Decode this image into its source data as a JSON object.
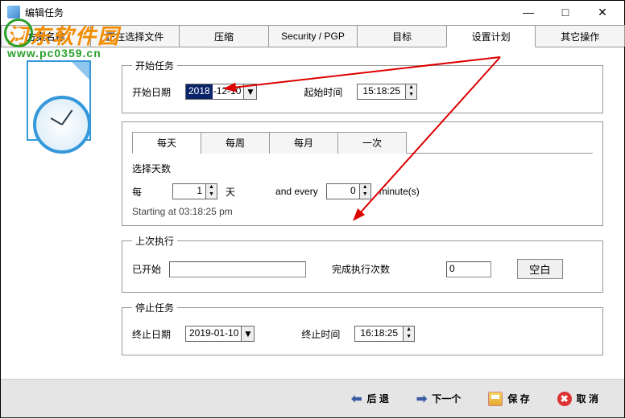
{
  "window": {
    "title": "编辑任务"
  },
  "watermark": {
    "main": "河东软件园",
    "sub": "www.pc0359.cn"
  },
  "tabs": [
    "方案名称",
    "正在选择文件",
    "压缩",
    "Security / PGP",
    "目标",
    "设置计划",
    "其它操作"
  ],
  "active_tab": 5,
  "start_task": {
    "legend": "开始任务",
    "date_label": "开始日期",
    "date_year": "2018",
    "date_rest": "-12-10",
    "time_label": "起始时间",
    "time_value": "15:18:25"
  },
  "freq_tabs": [
    "每天",
    "每周",
    "每月",
    "一次"
  ],
  "freq_active": 0,
  "days": {
    "label": "选择天数",
    "every_label": "每",
    "every_value": "1",
    "every_unit": "天",
    "and_every": "and every",
    "minute_value": "0",
    "minute_unit": "minute(s)",
    "starting": "Starting at 03:18:25 pm"
  },
  "last_run": {
    "legend": "上次执行",
    "started_label": "已开始",
    "started_value": "",
    "finish_label": "完成执行次数",
    "finish_value": "0",
    "clear_btn": "空白"
  },
  "stop_task": {
    "legend": "停止任务",
    "date_label": "终止日期",
    "date_value": "2019-01-10",
    "time_label": "终止时间",
    "time_value": "16:18:25"
  },
  "bottom": {
    "back": "后 退",
    "next": "下一个",
    "save": "保 存",
    "cancel": "取 消"
  }
}
